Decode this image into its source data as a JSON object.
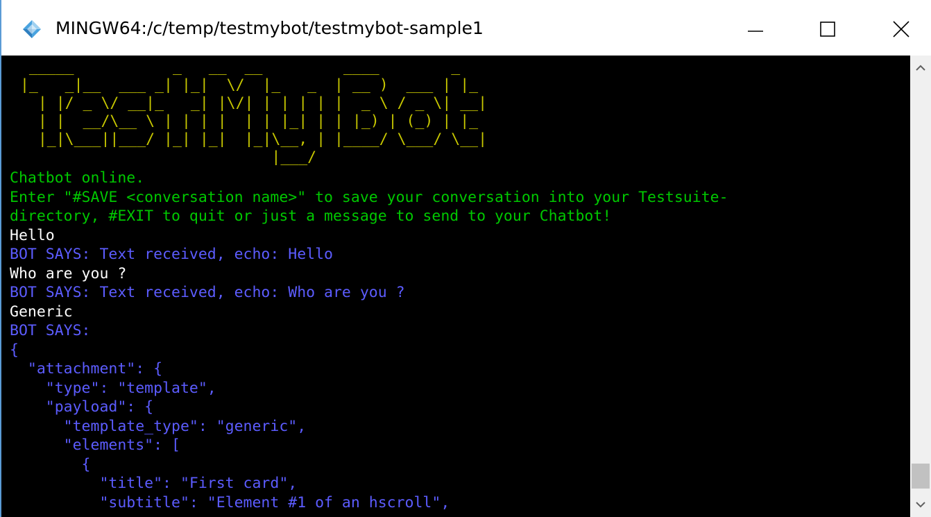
{
  "window": {
    "title": "MINGW64:/c/temp/testmybot/testmybot-sample1",
    "icon": "git-bash-icon",
    "controls": [
      "minimize-icon",
      "maximize-icon",
      "close-icon"
    ]
  },
  "colors": {
    "terminal_bg": "#000000",
    "banner": "#c8c800",
    "system_text": "#00c800",
    "user_text": "#ffffff",
    "bot_text": "#5c5cff"
  },
  "terminal": {
    "banner_art": [
      "  _____           _   __  __         ____        _   ",
      " |_   _|__  ___ _| |_|  \\/  |_   _  | __ )  ___ | |_ ",
      "   | |/ _ \\/ __|_   _| |\\/| | | | | |  _ \\ / _ \\| __|",
      "   | |  __/\\__ \\ | | | |  | | |_| | | |_) | (_) | |_ ",
      "   |_|\\___||___/ |_| |_|  |_|\\__, | |____/ \\___/ \\__|",
      "                             |___/                   "
    ],
    "lines": [
      {
        "kind": "system",
        "text": "Chatbot online."
      },
      {
        "kind": "system",
        "text": "Enter \"#SAVE <conversation name>\" to save your conversation into your Testsuite-"
      },
      {
        "kind": "system",
        "text": "directory, #EXIT to quit or just a message to send to your Chatbot!"
      },
      {
        "kind": "user",
        "text": "Hello"
      },
      {
        "kind": "bot",
        "text": "BOT SAYS: Text received, echo: Hello"
      },
      {
        "kind": "user",
        "text": "Who are you ?"
      },
      {
        "kind": "bot",
        "text": "BOT SAYS: Text received, echo: Who are you ?"
      },
      {
        "kind": "user",
        "text": "Generic"
      },
      {
        "kind": "bot",
        "text": "BOT SAYS:"
      },
      {
        "kind": "bot",
        "text": "{"
      },
      {
        "kind": "bot",
        "text": "  \"attachment\": {"
      },
      {
        "kind": "bot",
        "text": "    \"type\": \"template\","
      },
      {
        "kind": "bot",
        "text": "    \"payload\": {"
      },
      {
        "kind": "bot",
        "text": "      \"template_type\": \"generic\","
      },
      {
        "kind": "bot",
        "text": "      \"elements\": ["
      },
      {
        "kind": "bot",
        "text": "        {"
      },
      {
        "kind": "bot",
        "text": "          \"title\": \"First card\","
      },
      {
        "kind": "bot",
        "text": "          \"subtitle\": \"Element #1 of an hscroll\","
      }
    ]
  },
  "scrollbar": {
    "up_icon": "chevron-up-icon",
    "down_icon": "chevron-down-icon",
    "position": 0.95
  }
}
